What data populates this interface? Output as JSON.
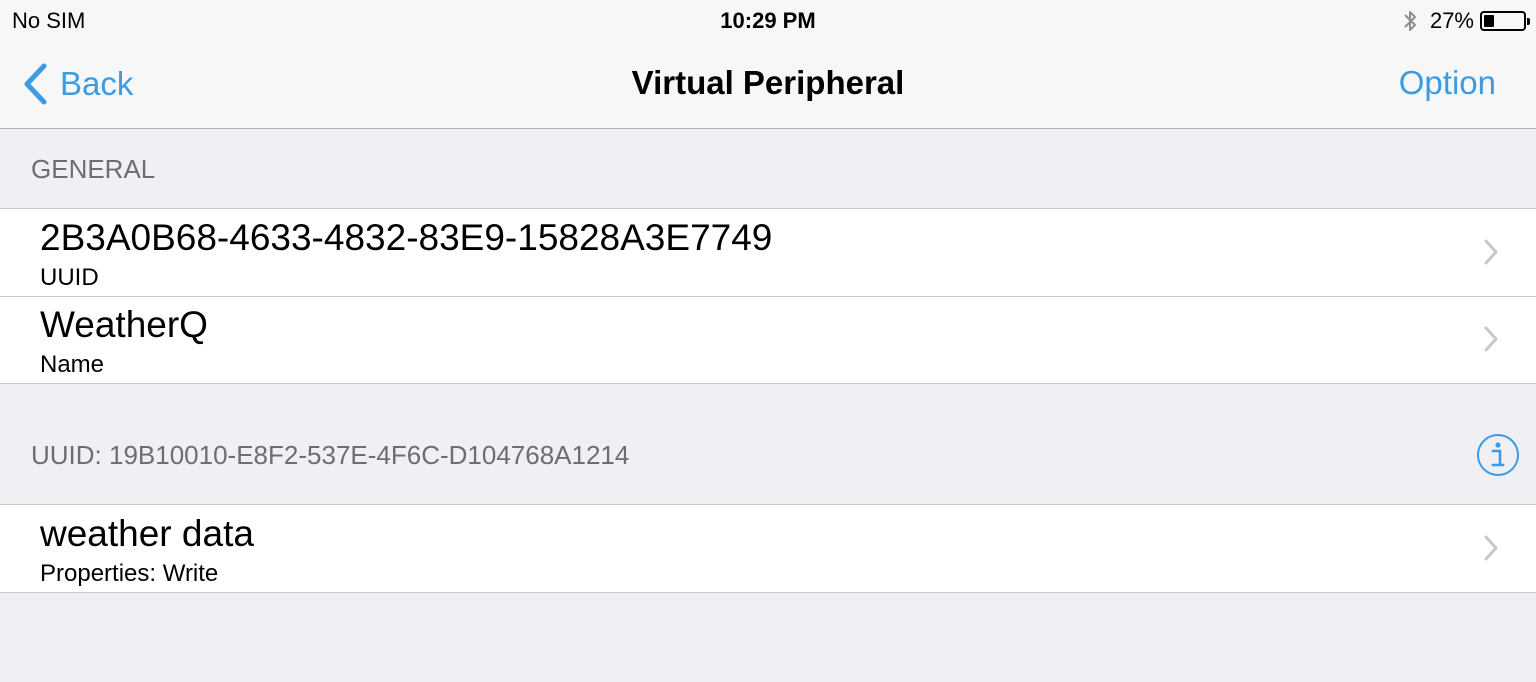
{
  "status_bar": {
    "carrier": "No SIM",
    "time": "10:29 PM",
    "battery_percent": "27%",
    "battery_level": 0.27,
    "icons": [
      "bluetooth-icon",
      "battery-icon"
    ]
  },
  "nav": {
    "back_label": "Back",
    "title": "Virtual Peripheral",
    "option_label": "Option",
    "accent_color": "#3c9be2"
  },
  "sections": {
    "general": {
      "header": "GENERAL",
      "rows": [
        {
          "title": "2B3A0B68-4633-4832-83E9-15828A3E7749",
          "subtitle": "UUID"
        },
        {
          "title": "WeatherQ",
          "subtitle": "Name"
        }
      ]
    },
    "service": {
      "header": "UUID: 19B10010-E8F2-537E-4F6C-D104768A1214",
      "rows": [
        {
          "title": "weather data",
          "subtitle": "Properties: Write"
        }
      ]
    }
  }
}
